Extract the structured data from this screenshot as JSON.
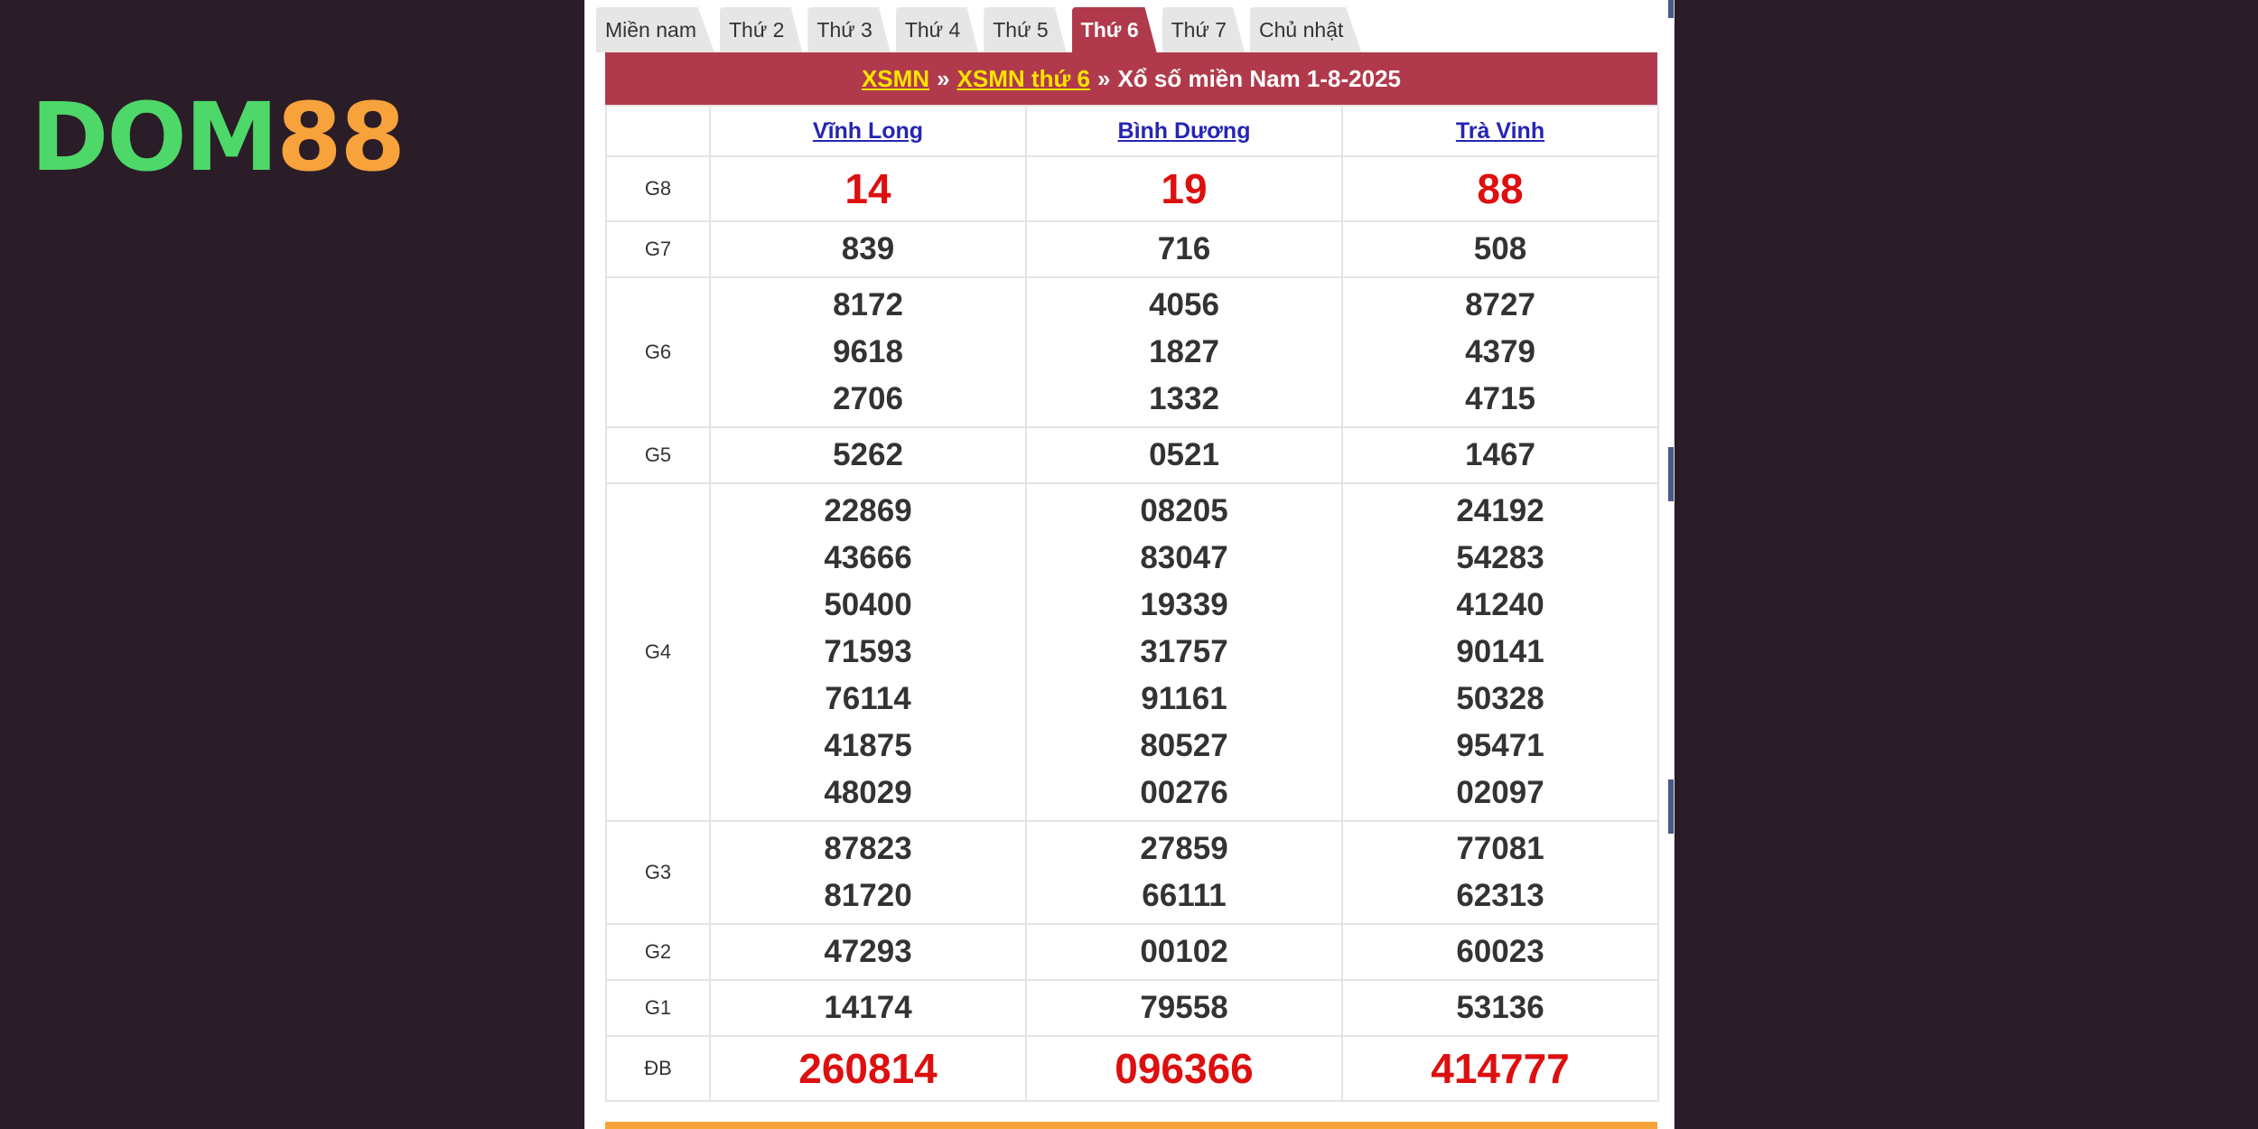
{
  "logo": {
    "part1": "DOM",
    "part2": "88"
  },
  "tabs": [
    {
      "label": "Miền nam",
      "active": false
    },
    {
      "label": "Thứ 2",
      "active": false
    },
    {
      "label": "Thứ 3",
      "active": false
    },
    {
      "label": "Thứ 4",
      "active": false
    },
    {
      "label": "Thứ 5",
      "active": false
    },
    {
      "label": "Thứ 6",
      "active": true
    },
    {
      "label": "Thứ 7",
      "active": false
    },
    {
      "label": "Chủ nhật",
      "active": false
    }
  ],
  "header": {
    "link1": "XSMN",
    "sep1": "»",
    "link2": "XSMN thứ 6",
    "sep2": "»",
    "title": "Xổ số miền Nam 1-8-2025"
  },
  "provinces": [
    "Vĩnh Long",
    "Bình Dương",
    "Trà Vinh"
  ],
  "prizes": [
    {
      "label": "G8",
      "style": "red",
      "values": [
        [
          "14"
        ],
        [
          "19"
        ],
        [
          "88"
        ]
      ]
    },
    {
      "label": "G7",
      "style": "normal",
      "values": [
        [
          "839"
        ],
        [
          "716"
        ],
        [
          "508"
        ]
      ]
    },
    {
      "label": "G6",
      "style": "normal",
      "values": [
        [
          "8172",
          "9618",
          "2706"
        ],
        [
          "4056",
          "1827",
          "1332"
        ],
        [
          "8727",
          "4379",
          "4715"
        ]
      ]
    },
    {
      "label": "G5",
      "style": "normal",
      "values": [
        [
          "5262"
        ],
        [
          "0521"
        ],
        [
          "1467"
        ]
      ]
    },
    {
      "label": "G4",
      "style": "normal",
      "values": [
        [
          "22869",
          "43666",
          "50400",
          "71593",
          "76114",
          "41875",
          "48029"
        ],
        [
          "08205",
          "83047",
          "19339",
          "31757",
          "91161",
          "80527",
          "00276"
        ],
        [
          "24192",
          "54283",
          "41240",
          "90141",
          "50328",
          "95471",
          "02097"
        ]
      ]
    },
    {
      "label": "G3",
      "style": "normal",
      "values": [
        [
          "87823",
          "81720"
        ],
        [
          "27859",
          "66111"
        ],
        [
          "77081",
          "62313"
        ]
      ]
    },
    {
      "label": "G2",
      "style": "normal",
      "values": [
        [
          "47293"
        ],
        [
          "00102"
        ],
        [
          "60023"
        ]
      ]
    },
    {
      "label": "G1",
      "style": "normal",
      "values": [
        [
          "14174"
        ],
        [
          "79558"
        ],
        [
          "53136"
        ]
      ]
    },
    {
      "label": "ĐB",
      "style": "red",
      "values": [
        [
          "260814"
        ],
        [
          "096366"
        ],
        [
          "414777"
        ]
      ]
    }
  ],
  "colors": {
    "background": "#2a1d27",
    "accent": "#b03a4b",
    "link_yellow": "#ffe400",
    "province_link": "#2525b4",
    "red_number": "#dd0f0f",
    "logo_green": "#4fd86a",
    "logo_orange": "#f7a23a",
    "bottom_bar": "#f6a43a"
  }
}
